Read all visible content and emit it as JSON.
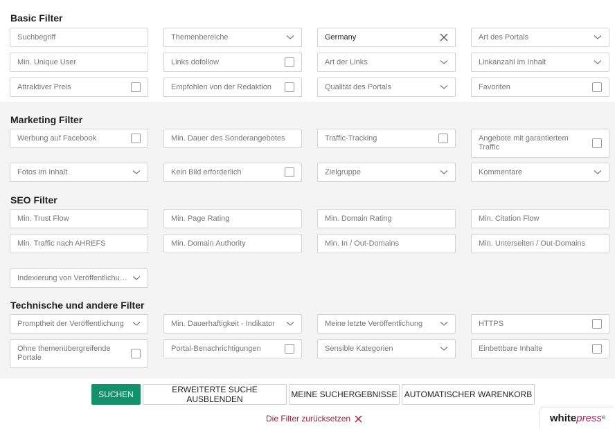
{
  "sections": {
    "basic": {
      "title": "Basic Filter",
      "fields": [
        {
          "label": "Suchbegriff",
          "type": "text"
        },
        {
          "label": "Themenbereiche",
          "type": "dropdown"
        },
        {
          "label": "Germany",
          "type": "clearable",
          "value": true
        },
        {
          "label": "Art des Portals",
          "type": "dropdown"
        },
        {
          "label": "Min. Unique User",
          "type": "text"
        },
        {
          "label": "Links dofollow",
          "type": "checkbox"
        },
        {
          "label": "Art der Links",
          "type": "dropdown"
        },
        {
          "label": "Linkanzahl im Inhalt",
          "type": "dropdown"
        },
        {
          "label": "Attraktiver Preis",
          "type": "checkbox"
        },
        {
          "label": "Empfohlen von der Redaktion",
          "type": "checkbox"
        },
        {
          "label": "Qualität des Portals",
          "type": "dropdown"
        },
        {
          "label": "Favoriten",
          "type": "checkbox"
        }
      ]
    },
    "marketing": {
      "title": "Marketing Filter",
      "fields": [
        {
          "label": "Werbung auf Facebook",
          "type": "checkbox"
        },
        {
          "label": "Min. Dauer des Sonderangebotes",
          "type": "text"
        },
        {
          "label": "Traffic-Tracking",
          "type": "checkbox"
        },
        {
          "label": "Angebote mit garantiertem Traffic",
          "type": "checkbox"
        },
        {
          "label": "Fotos im Inhalt",
          "type": "dropdown"
        },
        {
          "label": "Kein Bild erforderlich",
          "type": "checkbox"
        },
        {
          "label": "Zielgruppe",
          "type": "dropdown"
        },
        {
          "label": "Kommentare",
          "type": "dropdown"
        }
      ]
    },
    "seo": {
      "title": "SEO Filter",
      "fields": [
        {
          "label": "Min. Trust Flow",
          "type": "text"
        },
        {
          "label": "Min. Page Rating",
          "type": "text"
        },
        {
          "label": "Min. Domain Rating",
          "type": "text"
        },
        {
          "label": "Min. Citation Flow",
          "type": "text"
        },
        {
          "label": "Min. Traffic nach AHREFS",
          "type": "text"
        },
        {
          "label": "Min. Domain Authority",
          "type": "text"
        },
        {
          "label": "Min. In / Out-Domains",
          "type": "text"
        },
        {
          "label": "Min. Unterseiten / Out-Domains",
          "type": "text"
        },
        {
          "label": "Indexierung von Veröffentlichungen",
          "type": "dropdown"
        }
      ]
    },
    "technical": {
      "title": "Technische und andere Filter",
      "fields": [
        {
          "label": "Promptheit der Veröffentlichung",
          "type": "dropdown"
        },
        {
          "label": "Min. Dauerhaftigkeit - Indikator",
          "type": "dropdown"
        },
        {
          "label": "Meine letzte Veröffentlichung",
          "type": "dropdown"
        },
        {
          "label": "HTTPS",
          "type": "checkbox"
        },
        {
          "label": "Ohne themenübergreifende Portale",
          "type": "checkbox"
        },
        {
          "label": "Portal-Benachrichtigungen",
          "type": "checkbox"
        },
        {
          "label": "Sensible Kategorien",
          "type": "dropdown"
        },
        {
          "label": "Einbettbare Inhalte",
          "type": "checkbox"
        }
      ]
    }
  },
  "actions": {
    "search": "SUCHEN",
    "hide_advanced": "ERWEITERTE SUCHE AUSBLENDEN",
    "my_results": "MEINE SUCHERGEBNISSE",
    "auto_cart": "AUTOMATISCHER WARENKORB",
    "reset": "Die Filter zurücksetzen"
  },
  "brand": {
    "part1": "white",
    "part2": "press",
    "reg": "®",
    "accent": "#14916a",
    "reset_color": "#a11d3a"
  }
}
